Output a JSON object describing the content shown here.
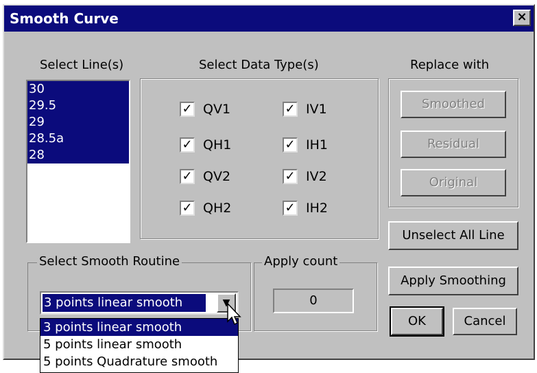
{
  "title": "Smooth Curve",
  "close_label": "×",
  "select_lines": {
    "label": "Select Line(s)",
    "items": [
      "30",
      "29.5",
      "29",
      "28.5a",
      "28"
    ]
  },
  "data_types": {
    "label": "Select Data Type(s)",
    "items": [
      {
        "label": "QV1",
        "checked": true
      },
      {
        "label": "IV1",
        "checked": true
      },
      {
        "label": "QH1",
        "checked": true
      },
      {
        "label": "IH1",
        "checked": true
      },
      {
        "label": "QV2",
        "checked": true
      },
      {
        "label": "IV2",
        "checked": true
      },
      {
        "label": "QH2",
        "checked": true
      },
      {
        "label": "IH2",
        "checked": true
      }
    ]
  },
  "replace_with": {
    "label": "Replace with",
    "smoothed": "Smoothed",
    "residual": "Residual",
    "original": "Original"
  },
  "buttons": {
    "unselect_all": "Unselect All Line",
    "apply_smoothing": "Apply Smoothing",
    "ok": "OK",
    "cancel": "Cancel"
  },
  "smooth_routine": {
    "label": "Select Smooth Routine",
    "selected": "3 points linear smooth",
    "options": [
      "3 points linear smooth",
      "5 points linear smooth",
      "5 points Quadrature smooth"
    ]
  },
  "apply_count": {
    "label": "Apply count",
    "value": "0"
  },
  "colors": {
    "title_bar": "#0b0b7c",
    "face": "#c0c0c0",
    "selection": "#0b0b7c"
  }
}
